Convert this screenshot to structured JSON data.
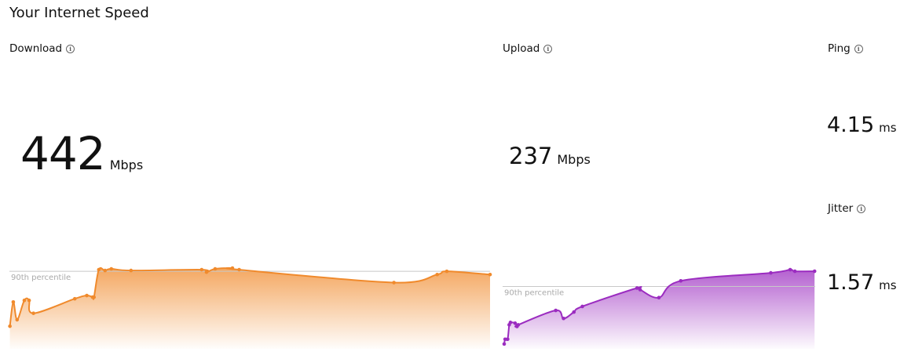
{
  "title": "Your Internet Speed",
  "download": {
    "label": "Download",
    "value": "442",
    "unit": "Mbps",
    "info_icon": "info-icon"
  },
  "upload": {
    "label": "Upload",
    "value": "237",
    "unit": "Mbps",
    "info_icon": "info-icon"
  },
  "ping": {
    "label": "Ping",
    "value": "4.15",
    "unit": "ms",
    "info_icon": "info-icon"
  },
  "jitter": {
    "label": "Jitter",
    "value": "1.57",
    "unit": "ms",
    "info_icon": "info-icon"
  },
  "colors": {
    "download": "#f08a2c",
    "upload": "#9b2cc0",
    "percentile_line": "#c8c8c8"
  },
  "chart_data": [
    {
      "type": "area",
      "series": [
        {
          "values": [
            28,
            58,
            36,
            60,
            60,
            44,
            62,
            66,
            64,
            64,
            98,
            97,
            99,
            97,
            98,
            95,
            99,
            100,
            98,
            82,
            92,
            96,
            92
          ]
        }
      ],
      "percentile_label": "90th percentile",
      "percentile_value": 96,
      "ylim": [
        0,
        100
      ]
    },
    {
      "type": "area",
      "series": [
        {
          "values": [
            6,
            12,
            12,
            30,
            33,
            32,
            28,
            30,
            48,
            38,
            46,
            53,
            76,
            74,
            64,
            85,
            95,
            99,
            97,
            97
          ]
        }
      ],
      "percentile_label": "90th percentile",
      "percentile_value": 78,
      "ylim": [
        0,
        100
      ]
    }
  ]
}
